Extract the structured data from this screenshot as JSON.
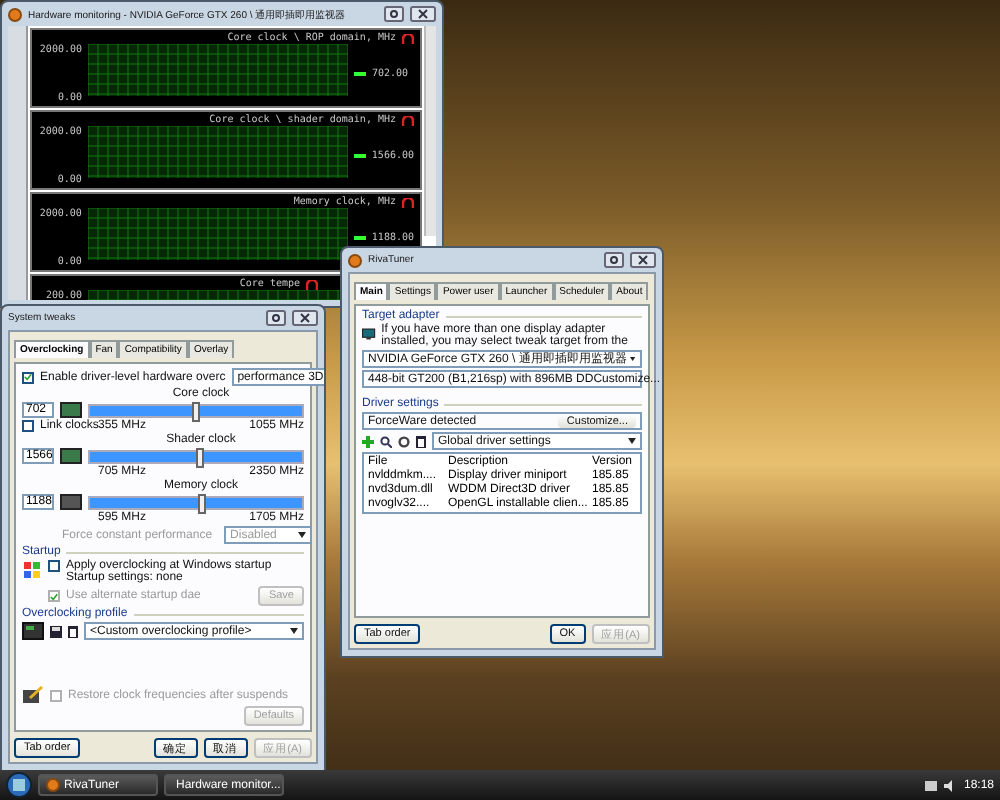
{
  "hardware_monitor": {
    "title": "Hardware monitoring - NVIDIA GeForce GTX 260 \\ 通用即插即用监视器",
    "graphs": [
      {
        "title": "Core clock \\ ROP domain, MHz",
        "max": "2000.00",
        "min": "0.00",
        "reading": "702.00"
      },
      {
        "title": "Core clock \\ shader domain, MHz",
        "max": "2000.00",
        "min": "0.00",
        "reading": "1566.00"
      },
      {
        "title": "Memory clock, MHz",
        "max": "2000.00",
        "min": "0.00",
        "reading": "1188.00"
      },
      {
        "title": "Core tempe",
        "max": "200.00"
      }
    ]
  },
  "system_tweaks": {
    "title": "System tweaks",
    "tabs": [
      {
        "label": "Overclocking",
        "selected": true
      },
      {
        "label": "Fan",
        "selected": false
      },
      {
        "label": "Compatibility",
        "selected": false
      },
      {
        "label": "Overlay",
        "selected": false
      }
    ],
    "enable": {
      "label": "Enable driver-level hardware overc",
      "checked": true
    },
    "mode": "performance 3D",
    "clocks": [
      {
        "title": "Core clock",
        "value": "702",
        "min": "355 MHz",
        "max": "1055 MHz",
        "level": 0.5
      },
      {
        "title": "Shader clock",
        "value": "1566",
        "min": "705 MHz",
        "max": "2350 MHz",
        "level": 0.52
      },
      {
        "title": "Memory clock",
        "value": "1188",
        "min": "595 MHz",
        "max": "1705 MHz",
        "level": 0.53
      }
    ],
    "link_clocks": {
      "label": "Link clocks",
      "checked": false
    },
    "force_label": "Force constant performance",
    "force_value": "Disabled",
    "startup_header": "Startup",
    "apply": {
      "label": "Apply overclocking at Windows startup",
      "checked": false
    },
    "startup_settings": "Startup settings: none",
    "alternate": {
      "label": "Use alternate startup dae",
      "checked": true,
      "disabled": true
    },
    "save": "Save",
    "profile_header": "Overclocking profile",
    "profile": "<Custom overclocking profile>",
    "restore": {
      "label": "Restore clock frequencies after suspends",
      "checked": false,
      "disabled": true
    },
    "defaults": "Defaults",
    "buttons": [
      {
        "label": "Tab order",
        "disabled": false
      },
      {
        "label": "确定",
        "disabled": false
      },
      {
        "label": "取消",
        "disabled": false
      },
      {
        "label": "应用(A)",
        "disabled": true
      }
    ]
  },
  "rivatuner": {
    "title": "RivaTuner",
    "tabs": [
      {
        "label": "Main",
        "selected": true
      },
      {
        "label": "Settings",
        "selected": false
      },
      {
        "label": "Power user",
        "selected": false
      },
      {
        "label": "Launcher",
        "selected": false
      },
      {
        "label": "Scheduler",
        "selected": false
      },
      {
        "label": "About",
        "selected": false
      }
    ],
    "target_header": "Target adapter",
    "target_text": "If you have more than one display adapter installed, you may select tweak target from the",
    "adapter": "NVIDIA GeForce GTX 260 \\ 通用即插即用监视器",
    "adapter_info": "448-bit GT200 (B1,216sp) with 896MB DDCustomize...",
    "driver_header": "Driver settings",
    "driver_detected": "ForceWare detected",
    "customize": "Customize...",
    "driver_profile": "Global driver settings",
    "columns": [
      "File",
      "Description",
      "Version"
    ],
    "rows": [
      [
        "nvlddmkm....",
        "Display driver miniport",
        "185.85"
      ],
      [
        "nvd3dum.dll",
        "WDDM Direct3D driver",
        "185.85"
      ],
      [
        "nvoglv32....",
        "OpenGL installable clien...",
        "185.85"
      ]
    ],
    "buttons": [
      {
        "label": "Tab order",
        "disabled": false
      },
      {
        "label": "OK",
        "disabled": false
      },
      {
        "label": "应用(A)",
        "disabled": true
      }
    ]
  },
  "taskbar": {
    "buttons": [
      "RivaTuner",
      "Hardware monitor..."
    ],
    "clock": "18:18"
  }
}
